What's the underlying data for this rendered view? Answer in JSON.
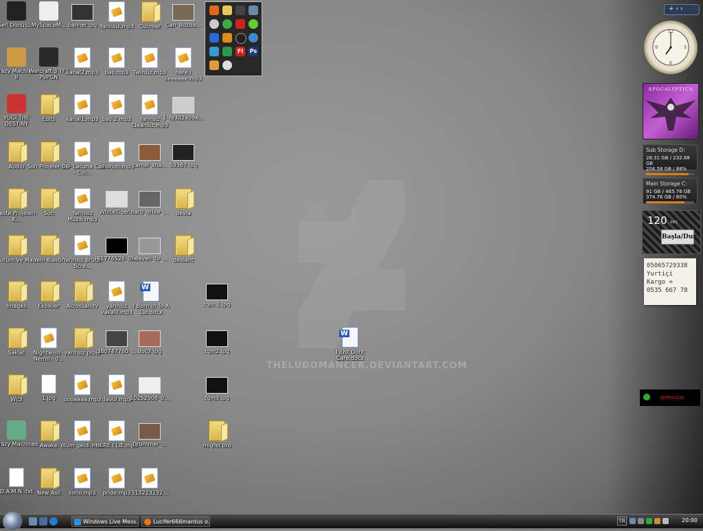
{
  "desktop": {
    "watermark": "THELUDOMANCER.DEVIANTART.COM",
    "icons": [
      {
        "label": "Geri Dönüşü...",
        "kind": "app",
        "color": "#222"
      },
      {
        "label": "MySpaceM...",
        "kind": "app",
        "color": "#eee"
      },
      {
        "label": "banner.jpg",
        "kind": "img",
        "color": "#333"
      },
      {
        "label": "Yarınsız.mp3",
        "kind": "mp3"
      },
      {
        "label": "Çizimler",
        "kind": "folder"
      },
      {
        "label": "Can_Bozda...",
        "kind": "img",
        "color": "#7a6a55"
      },
      {
        "label": "Crazy Machines II",
        "kind": "app",
        "color": "#c94"
      },
      {
        "label": "Warcraft 3 TFT PvPGN",
        "kind": "app",
        "color": "#2a2a2a"
      },
      {
        "label": "kanal2.mp3",
        "kind": "mp3"
      },
      {
        "label": "baş.mp3",
        "kind": "mp3"
      },
      {
        "label": "Twinsiz.mp3",
        "kind": "mp3"
      },
      {
        "label": "here i lieeeeee.mp3",
        "kind": "mp3"
      },
      {
        "label": "YUGI THE DESTINY",
        "kind": "app",
        "color": "#c33"
      },
      {
        "label": "Edits",
        "kind": "folder"
      },
      {
        "label": "kanal1.mp3",
        "kind": "mp3"
      },
      {
        "label": "baş 2.mp3",
        "kind": "mp3"
      },
      {
        "label": "Yarınsız Cleansiz.mp3",
        "kind": "mp3"
      },
      {
        "label": "1_fe3d2e09e...",
        "kind": "img",
        "color": "#ccc"
      },
      {
        "label": "Audio",
        "kind": "folder"
      },
      {
        "label": "Son Projeler E.P",
        "kind": "folder"
      },
      {
        "label": "-06- Lacuna Coil - Col...",
        "kind": "mp3"
      },
      {
        "label": "ohohoh.mp3",
        "kind": "mp3"
      },
      {
        "label": "camel_sha...",
        "kind": "img",
        "color": "#8a5a3a"
      },
      {
        "label": "59367.jpg",
        "kind": "img",
        "color": "#222"
      },
      {
        "label": "Beste Projeleri-K...",
        "kind": "folder"
      },
      {
        "label": "Son",
        "kind": "folder"
      },
      {
        "label": "Yarınsız Müzik.mp3",
        "kind": "mp3"
      },
      {
        "label": "WhiteTiger...",
        "kind": "img",
        "color": "#ddd"
      },
      {
        "label": "hard_drive_...",
        "kind": "img",
        "color": "#666"
      },
      {
        "label": "devia",
        "kind": "folder"
      },
      {
        "label": "Forum Ve Mail",
        "kind": "folder"
      },
      {
        "label": "Yeni Klasör",
        "kind": "folder"
      },
      {
        "label": "Yarınsız Brutal Scre...",
        "kind": "mp3"
      },
      {
        "label": "81776526_0...",
        "kind": "img",
        "color": "#000"
      },
      {
        "label": "heaven_to_...",
        "kind": "img",
        "color": "#999"
      },
      {
        "label": "deviant",
        "kind": "folder"
      },
      {
        "label": "Images",
        "kind": "folder"
      },
      {
        "label": "Eksikler",
        "kind": "folder"
      },
      {
        "label": "Acrossanity",
        "kind": "folder"
      },
      {
        "label": "yarınsız vakalll.mp3",
        "kind": "mp3"
      },
      {
        "label": "I Born In To A Lie.docx",
        "kind": "doc"
      },
      {
        "label": "tgm 1.jpg",
        "kind": "img",
        "color": "#111"
      },
      {
        "label": "Sakla!",
        "kind": "folder"
      },
      {
        "label": "Nightwish - Nemo - 0...",
        "kind": "mp3"
      },
      {
        "label": "yarınsız proje",
        "kind": "folder"
      },
      {
        "label": "380747760_...",
        "kind": "img",
        "color": "#444"
      },
      {
        "label": "doc7.jpg",
        "kind": "img",
        "color": "#a86a5a"
      },
      {
        "label": "tgm2.jpg",
        "kind": "img",
        "color": "#111"
      },
      {
        "label": "Wc3",
        "kind": "folder"
      },
      {
        "label": "1.jpg",
        "kind": "txt"
      },
      {
        "label": "oooaaaa.mp3",
        "kind": "mp3"
      },
      {
        "label": "davul.mp3",
        "kind": "mp3"
      },
      {
        "label": "10252508_0...",
        "kind": "img",
        "color": "#eee"
      },
      {
        "label": "tgm3.jpg",
        "kind": "img",
        "color": "#111"
      },
      {
        "label": "Crazy Machines",
        "kind": "app",
        "color": "#6a8"
      },
      {
        "label": "Awake",
        "kind": "folder"
      },
      {
        "label": "ölüm geldi.mp3",
        "kind": "mp3"
      },
      {
        "label": "HERE I LIE.mp3",
        "kind": "mp3"
      },
      {
        "label": "Drummer_...",
        "kind": "img",
        "color": "#7a5a4a"
      },
      {
        "label": "miğfer.pro",
        "kind": "folder"
      },
      {
        "label": "D.A.M.N..txt",
        "kind": "txt"
      },
      {
        "label": "New Asil",
        "kind": "folder"
      },
      {
        "label": "sono.mp3",
        "kind": "mp3"
      },
      {
        "label": "pride.mp3",
        "kind": "mp3"
      },
      {
        "label": "313213232...",
        "kind": "mp3"
      },
      {
        "label": "I Just Dont Care.docx",
        "kind": "doc"
      }
    ]
  },
  "gadgets": {
    "sidebar_controls": "+ ‹ ›",
    "album_title": "APOCALYPTICA",
    "drive_d": {
      "title": "Sub Storage D:",
      "line1": "28.31 GB / 232.88 GB",
      "line2": "204.58 GB / 88%",
      "used": 0.88
    },
    "drive_c": {
      "title": "Main Storage C:",
      "line1": "91 GB / 465.76 GB",
      "line2": "374.76 GB / 80%",
      "used": 0.8
    },
    "timer": {
      "value": "120",
      "unit": "sec",
      "button": "Başla/Dur"
    },
    "note": {
      "line1": "05065729338",
      "line2": "Yurtiçi Kargo =",
      "line3": "0535 667 78"
    },
    "msn_label": "GothicCat"
  },
  "taskbar": {
    "tasks": [
      {
        "label": "Windows Live Mess...",
        "color": "#3a8ad0"
      },
      {
        "label": "Lucifer666mantus o...",
        "color": "#e07a1a"
      }
    ],
    "language": "TR",
    "time": "20:00"
  }
}
